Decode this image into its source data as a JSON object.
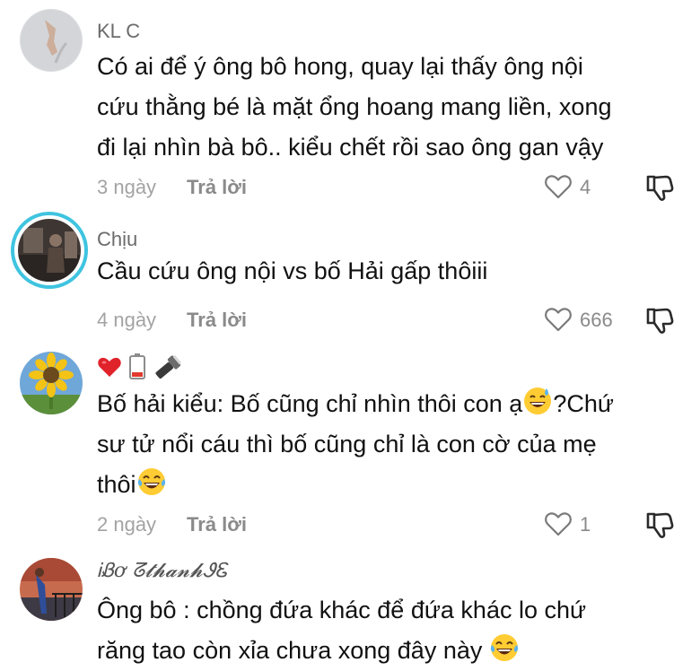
{
  "comments": [
    {
      "username": "KL C",
      "lines": [
        "Có ai để ý ông bô hong, quay lại thấy ông nội",
        "cứu thằng bé là mặt ổng hoang mang liền, xong",
        "đi lại nhìn bà bô.. kiểu chết rồi sao ông gan vậy"
      ],
      "time": "3 ngày",
      "reply_label": "Trả lời",
      "likes": "4"
    },
    {
      "username": "Chịu",
      "lines": [
        "Cầu cứu ông nội vs bố Hải gấp thôiii"
      ],
      "time": "4 ngày",
      "reply_label": "Trả lời",
      "likes": "666"
    },
    {
      "username_emojis": [
        "red-heart",
        "low-battery",
        "flashlight"
      ],
      "lines": [
        "Bố hải kiểu: Bố cũng chỉ nhìn thôi con ạ",
        "?Chứ",
        "sư tử nổi cáu thì bố cũng chỉ là con cờ của mẹ",
        "thôi"
      ],
      "time": "2 ngày",
      "reply_label": "Trả lời",
      "likes": "1"
    },
    {
      "username": "ᎥᏰơ ᘔ𝓽𝓱𝓪𝓷𝓱ᏭᏋ",
      "lines": [
        "Ông bô : chồng đứa khác để đứa khác lo chứ",
        "răng tao còn xỉa chưa xong đây này"
      ]
    }
  ],
  "colors": {
    "text": "#111111",
    "username": "#6b6b6b",
    "meta": "#a3a3a3",
    "story_ring": "#3fc4e0"
  },
  "icons": [
    "heart-outline-icon",
    "thumbs-down-icon",
    "smiling-sweat-emoji",
    "tears-of-joy-emoji"
  ]
}
